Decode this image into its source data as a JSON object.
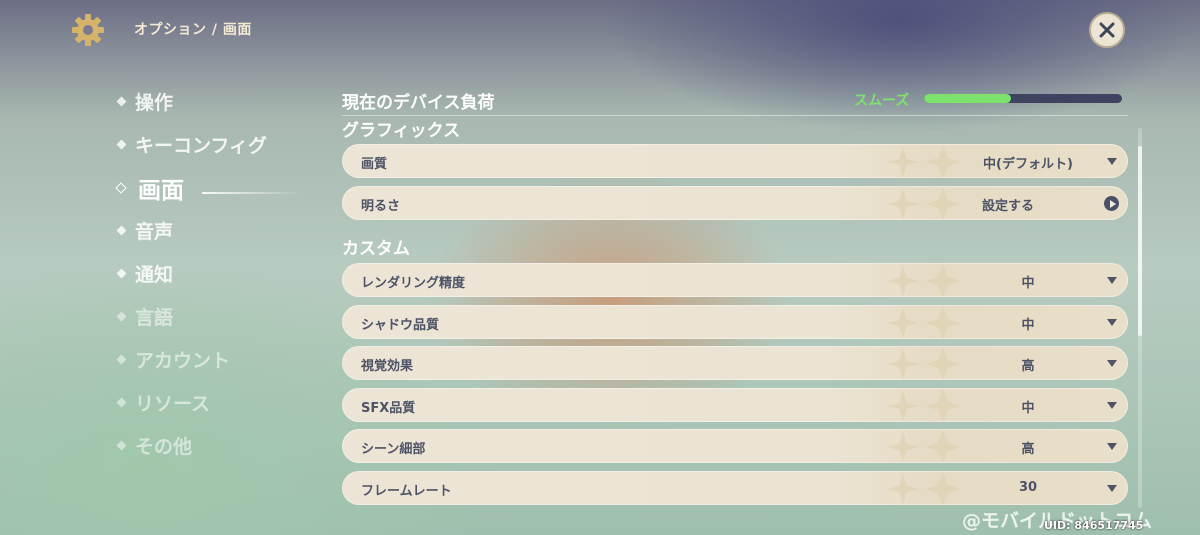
{
  "header": {
    "breadcrumb": "オプション / 画面",
    "settings_icon": "gear-icon",
    "close_icon": "close-icon"
  },
  "sidebar": {
    "items": [
      {
        "label": "操作"
      },
      {
        "label": "キーコンフィグ"
      },
      {
        "label": "画面",
        "active": true
      },
      {
        "label": "音声"
      },
      {
        "label": "通知"
      },
      {
        "label": "言語"
      },
      {
        "label": "アカウント"
      },
      {
        "label": "リソース"
      },
      {
        "label": "その他"
      }
    ]
  },
  "device_load": {
    "label": "現在のデバイス負荷",
    "status": "スムーズ",
    "level": 0.44,
    "color": "#7de36c"
  },
  "sections": {
    "graphics_title": "グラフィックス",
    "custom_title": "カスタム"
  },
  "graphics_settings": [
    {
      "label": "画質",
      "value": "中(デフォルト)",
      "control": "dropdown"
    },
    {
      "label": "明るさ",
      "value": "設定する",
      "control": "link"
    }
  ],
  "custom_settings": [
    {
      "label": "レンダリング精度",
      "value": "中"
    },
    {
      "label": "シャドウ品質",
      "value": "中"
    },
    {
      "label": "視覚効果",
      "value": "高"
    },
    {
      "label": "SFX品質",
      "value": "中"
    },
    {
      "label": "シーン細部",
      "value": "高"
    },
    {
      "label": "フレームレート",
      "value": "30"
    }
  ],
  "footer": {
    "watermark": "@モバイルドットコム",
    "uid": "UID: 846517745"
  }
}
